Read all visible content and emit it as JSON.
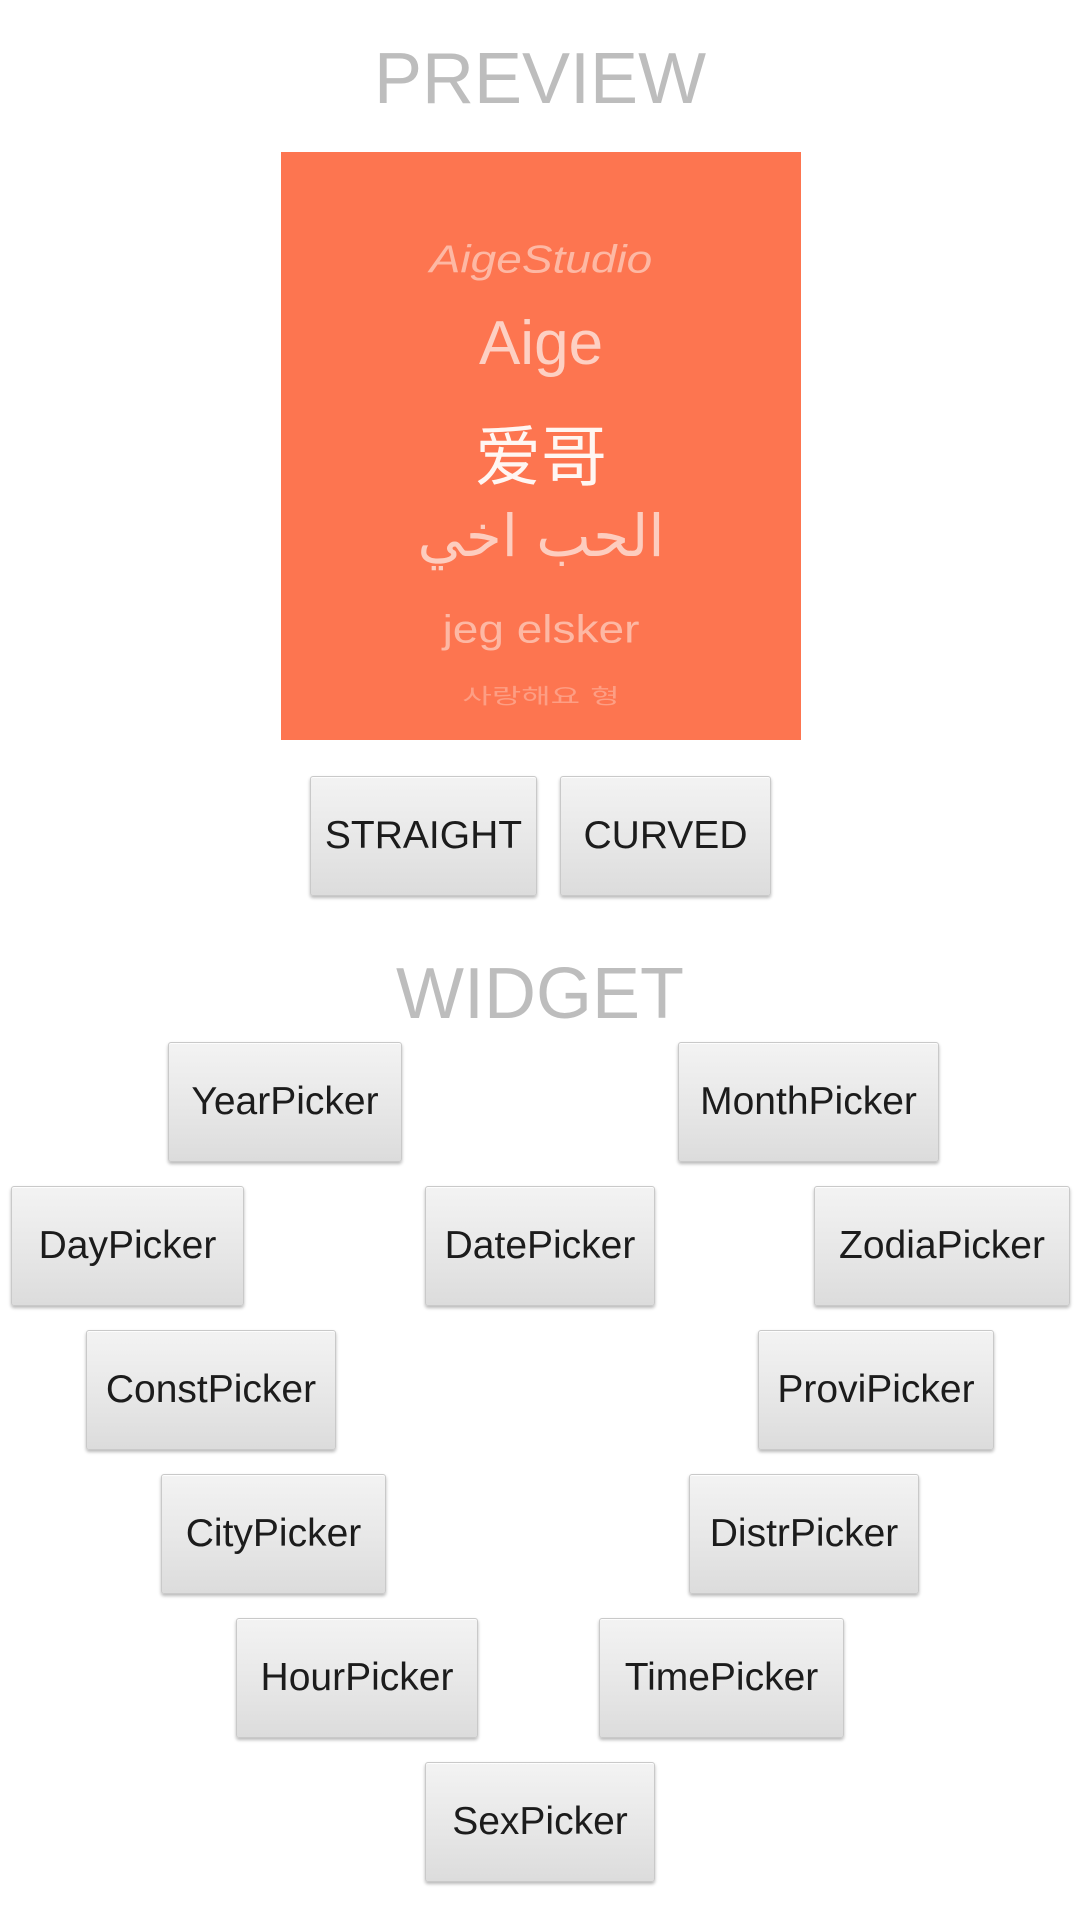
{
  "sections": {
    "preview_title": "PREVIEW",
    "widget_title": "WIDGET"
  },
  "preview": {
    "background_color": "#fd7550",
    "items": [
      "AigeStudio",
      "Aige",
      "爱哥",
      "الحب اخي",
      "jeg elsker",
      "사랑해요 형"
    ],
    "selected_item": "爱哥"
  },
  "mode_buttons": {
    "straight": "STRAIGHT",
    "curved": "CURVED"
  },
  "widgets": {
    "year": "YearPicker",
    "month": "MonthPicker",
    "day": "DayPicker",
    "date": "DatePicker",
    "zodia": "ZodiaPicker",
    "const": "ConstPicker",
    "provi": "ProviPicker",
    "city": "CityPicker",
    "distr": "DistrPicker",
    "hour": "HourPicker",
    "time": "TimePicker",
    "sex": "SexPicker"
  }
}
